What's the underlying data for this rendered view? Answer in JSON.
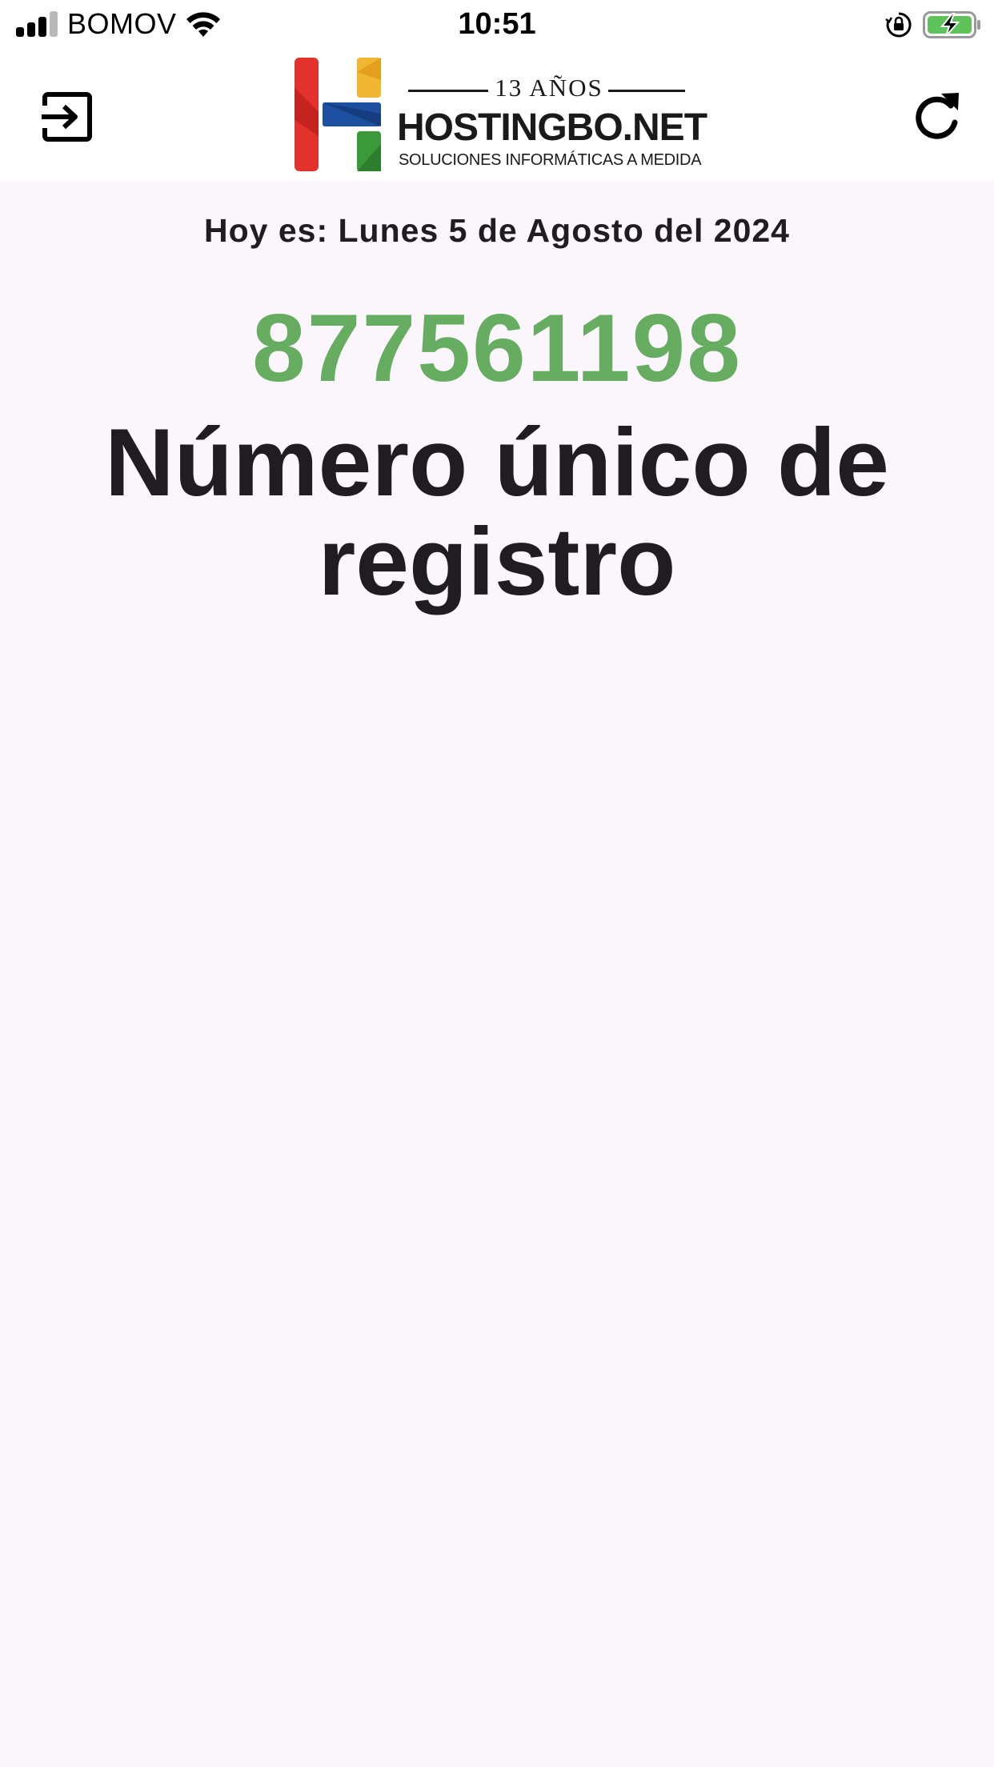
{
  "status_bar": {
    "carrier": "BOMOV",
    "time": "10:51",
    "icons": [
      "signal-icon",
      "wifi-icon",
      "rotation-lock-icon",
      "battery-charging-icon"
    ]
  },
  "header": {
    "exit_icon": "exit-icon",
    "refresh_icon": "refresh-icon",
    "logo": {
      "years": "13 AÑOS",
      "name": "HOSTINGBO.NET",
      "tagline": "SOLUCIONES INFORMÁTICAS A MEDIDA",
      "colors": [
        "#e3312c",
        "#f1b733",
        "#1d4fa0",
        "#3a9a3a"
      ]
    }
  },
  "main": {
    "date_text": "Hoy es: Lunes 5 de Agosto del 2024",
    "registration_number": "877561198",
    "registration_label": "Número único de registro"
  },
  "colors": {
    "accent_green": "#66ad62",
    "background": "#fbf5fc",
    "text": "#1f1d22"
  }
}
